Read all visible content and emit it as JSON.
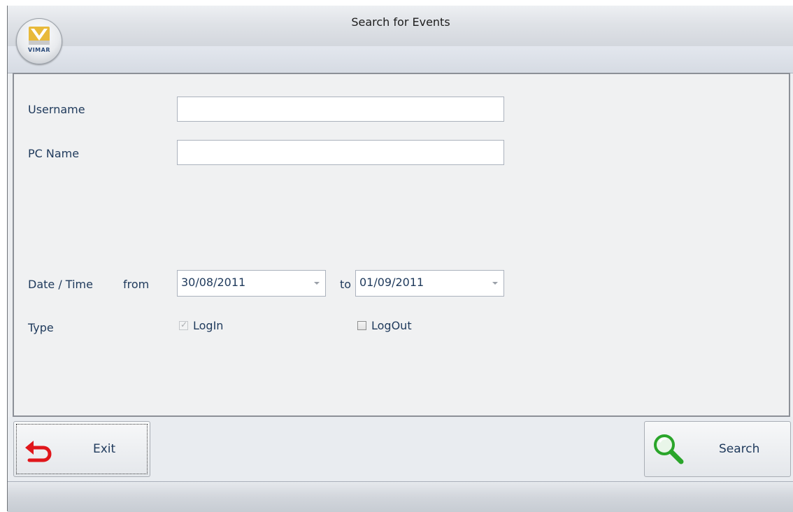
{
  "window": {
    "title": "Search for Events"
  },
  "logo": {
    "brand": "VIMAR"
  },
  "form": {
    "username_label": "Username",
    "username_value": "",
    "pcname_label": "PC Name",
    "pcname_value": "",
    "datetime_label": "Date / Time",
    "from_label": "from",
    "from_date": "30/08/2011",
    "to_label": "to",
    "to_date": "01/09/2011",
    "type_label": "Type",
    "type_options": [
      {
        "label": "LogIn",
        "checked": true,
        "enabled": false
      },
      {
        "label": "LogOut",
        "checked": false,
        "enabled": true
      }
    ]
  },
  "buttons": {
    "exit_label": "Exit",
    "search_label": "Search"
  },
  "colors": {
    "label_text": "#1e395b",
    "exit_icon": "#e0161b",
    "search_icon": "#2aa52a"
  },
  "icons": [
    "logo-icon",
    "exit-arrow-icon",
    "search-magnifier-icon",
    "dropdown-arrow-icon"
  ]
}
